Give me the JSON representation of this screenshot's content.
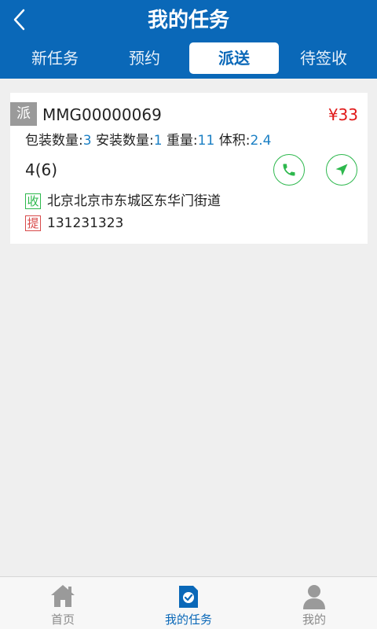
{
  "header": {
    "title": "我的任务",
    "back_icon": "chevron-left-icon",
    "bg_color": "#0a68b8"
  },
  "tabs": [
    {
      "label": "新任务",
      "active": false
    },
    {
      "label": "预约",
      "active": false
    },
    {
      "label": "派送",
      "active": true
    },
    {
      "label": "待签收",
      "active": false
    }
  ],
  "task_card": {
    "type_badge": "派",
    "order_no": "MMG00000069",
    "price": "¥33",
    "specs": {
      "pack_label": "包装数量:",
      "pack_value": "3",
      "install_label": "安装数量:",
      "install_value": "1",
      "weight_label": "重量:",
      "weight_value": "11",
      "volume_label": "体积:",
      "volume_value": "2.4"
    },
    "quantity": "4(6)",
    "receive_seal": "收",
    "address": "北京北京市东城区东华门街道",
    "pickup_seal": "提",
    "phone": "131231323",
    "call_icon": "phone-icon",
    "nav_icon": "navigation-arrow-icon"
  },
  "bottom_nav": [
    {
      "label": "首页",
      "icon": "home-icon",
      "active": false
    },
    {
      "label": "我的任务",
      "icon": "task-check-icon",
      "active": true
    },
    {
      "label": "我的",
      "icon": "user-icon",
      "active": false
    }
  ],
  "colors": {
    "primary": "#0a68b8",
    "price_red": "#e01818",
    "value_blue": "#1a7fc4",
    "action_green": "#2db84d"
  }
}
